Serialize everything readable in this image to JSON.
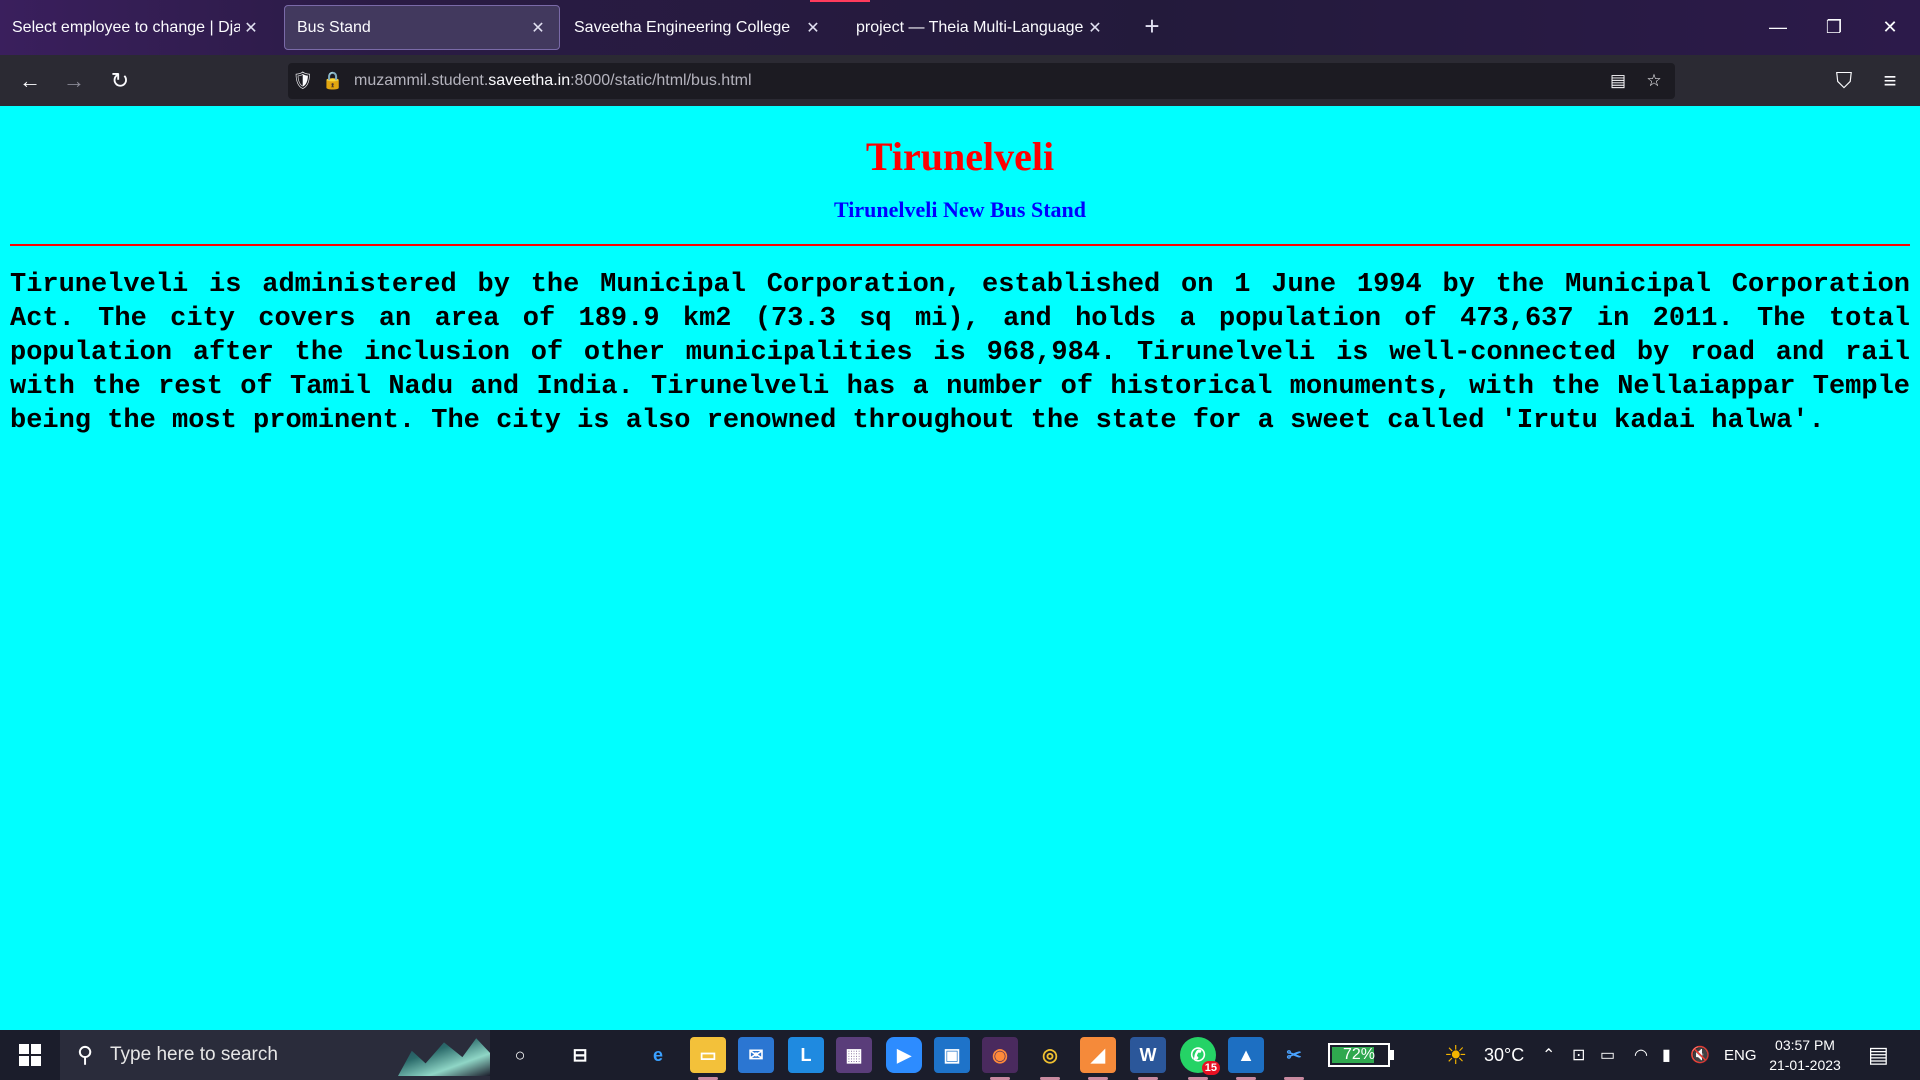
{
  "browser": {
    "tabs": [
      {
        "label": "Select employee to change | Django",
        "active": false
      },
      {
        "label": "Bus Stand",
        "active": true
      },
      {
        "label": "Saveetha Engineering College",
        "active": false
      },
      {
        "label": "project — Theia Multi-Language Ex",
        "active": false
      }
    ],
    "url": {
      "prefix": "muzammil.student.",
      "host": "saveetha.in",
      "suffix": ":8000/static/html/bus.html"
    }
  },
  "page": {
    "title": "Tirunelveli",
    "subtitle": "Tirunelveli New Bus Stand",
    "body": "Tirunelveli is administered by the Municipal Corporation, established on 1 June 1994 by the Municipal Corporation Act. The city covers an area of 189.9 km2 (73.3 sq mi), and holds a population of 473,637 in 2011. The total population after the inclusion of other municipalities is 968,984. Tirunelveli is well-connected by road and rail with the rest of Tamil Nadu and India. Tirunelveli has a number of historical monuments, with the Nellaiappar Temple being the most prominent. The city is also renowned throughout the state for a sweet called 'Irutu kadai halwa'.",
    "colors": {
      "background": "#00ffff",
      "title": "#ff0000",
      "subtitle": "#0000ff",
      "rule": "#ff0000"
    }
  },
  "taskbar": {
    "search_placeholder": "Type here to search",
    "whatsapp_badge": "15",
    "battery": {
      "label": "72%",
      "level": 0.72
    },
    "weather": "30°C",
    "language": "ENG",
    "time": "03:57 PM",
    "date": "21-01-2023"
  }
}
